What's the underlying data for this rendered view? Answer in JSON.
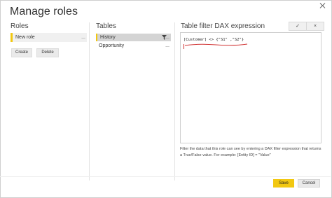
{
  "dialog": {
    "title": "Manage roles"
  },
  "roles": {
    "heading": "Roles",
    "items": [
      {
        "label": "New role",
        "selected": true
      }
    ],
    "more_label": "...",
    "create_label": "Create",
    "delete_label": "Delete"
  },
  "tables": {
    "heading": "Tables",
    "more_label": "...",
    "items": [
      {
        "label": "History",
        "selected": true
      },
      {
        "label": "Opportunity",
        "selected": false
      }
    ]
  },
  "dax": {
    "heading": "Table filter DAX expression",
    "check_label": "✓",
    "cancel_label": "×",
    "expression": "[Customer] <> {\"S1\" ,\"S2\"}",
    "help_text": "Filter the data that this role can see by entering a DAX filter expression that returns a True/False value. For example: [Entity ID] = \"Value\""
  },
  "footer": {
    "save_label": "Save",
    "cancel_label": "Cancel"
  },
  "colors": {
    "accent": "#f2c811",
    "annotation": "#d03030"
  }
}
